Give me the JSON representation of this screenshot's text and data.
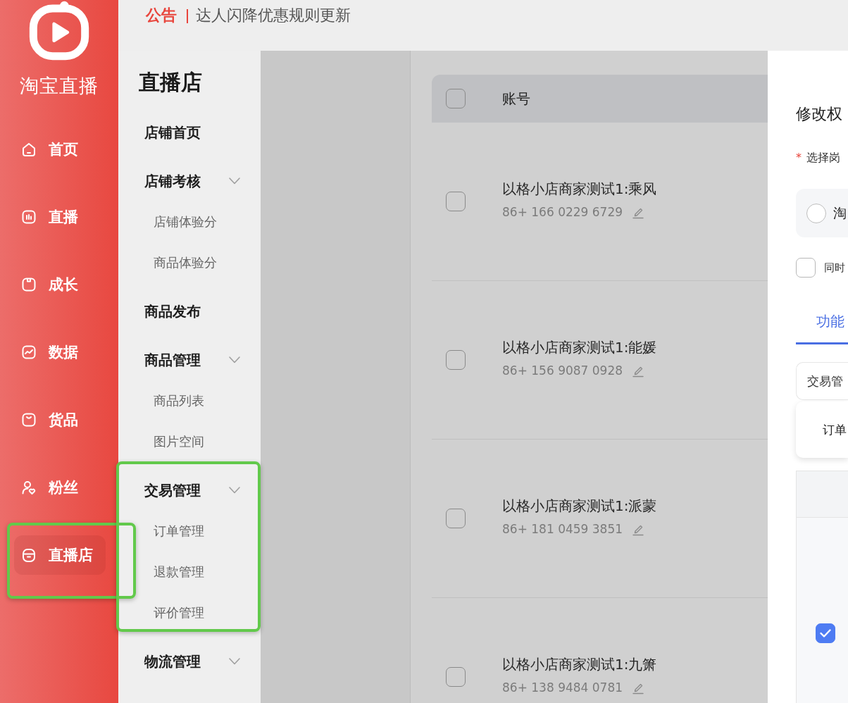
{
  "brand": {
    "name": "淘宝直播"
  },
  "nav": [
    {
      "label": "首页",
      "selected": false
    },
    {
      "label": "直播",
      "selected": false
    },
    {
      "label": "成长",
      "selected": false
    },
    {
      "label": "数据",
      "selected": false
    },
    {
      "label": "货品",
      "selected": false
    },
    {
      "label": "粉丝",
      "selected": false
    },
    {
      "label": "直播店",
      "selected": true
    }
  ],
  "announcement": {
    "tag": "公告",
    "text": "达人闪降优惠规则更新"
  },
  "section_menu": {
    "title": "直播店",
    "items": [
      {
        "kind": "link",
        "label": "店铺首页"
      },
      {
        "kind": "group",
        "label": "店铺考核",
        "expanded": true,
        "children": [
          {
            "label": "店铺体验分"
          },
          {
            "label": "商品体验分"
          }
        ]
      },
      {
        "kind": "link",
        "label": "商品发布"
      },
      {
        "kind": "group",
        "label": "商品管理",
        "expanded": true,
        "children": [
          {
            "label": "商品列表"
          },
          {
            "label": "图片空间"
          }
        ]
      },
      {
        "kind": "group",
        "label": "交易管理",
        "expanded": true,
        "children": [
          {
            "label": "订单管理"
          },
          {
            "label": "退款管理"
          },
          {
            "label": "评价管理"
          }
        ]
      },
      {
        "kind": "group",
        "label": "物流管理",
        "expanded": true
      }
    ]
  },
  "account_table": {
    "header": {
      "label": "账号",
      "checked": false
    },
    "rows": [
      {
        "name": "以格小店商家测试1:乘风",
        "phone": "86+ 166 0229 6729",
        "checked": false
      },
      {
        "name": "以格小店商家测试1:能媛",
        "phone": "86+ 156 9087 0928",
        "checked": false
      },
      {
        "name": "以格小店商家测试1:派蒙",
        "phone": "86+ 181 0459 3851",
        "checked": false
      },
      {
        "name": "以格小店商家测试1:九箫",
        "phone": "86+ 138 9484 0781",
        "checked": false
      }
    ]
  },
  "drawer": {
    "title": "修改权",
    "field": {
      "required_mark": "*",
      "label": "选择岗"
    },
    "role_option": {
      "label": "淘",
      "selected": false
    },
    "sync_option": {
      "label": "同时",
      "checked": false
    },
    "tabs": [
      {
        "label": "功能",
        "selected": true
      }
    ],
    "module": "交易管",
    "submodule": "订单",
    "table_rows": [
      {
        "checked": true
      }
    ]
  }
}
